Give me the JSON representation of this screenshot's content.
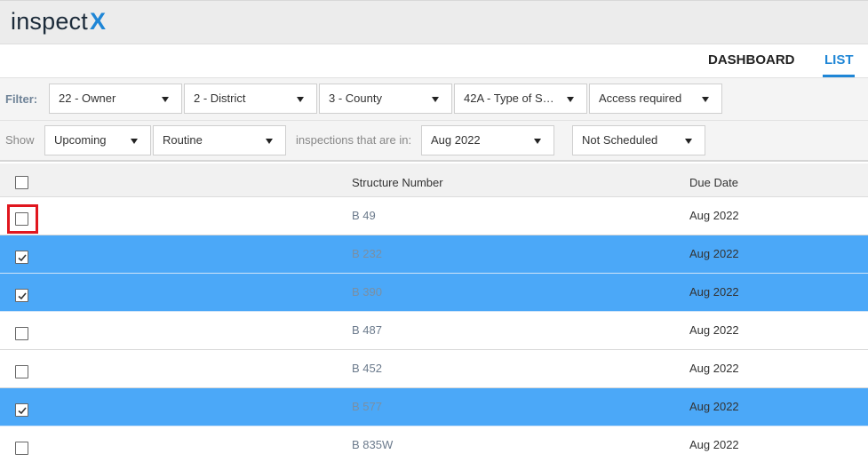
{
  "app": {
    "logo_text": "inspect",
    "logo_accent": "X"
  },
  "nav": {
    "dashboard": "DASHBOARD",
    "list": "LIST",
    "active": "LIST"
  },
  "filters": {
    "label": "Filter:",
    "owner": "22 - Owner",
    "district": "2 - District",
    "county": "3 - County",
    "type": "42A - Type of S…",
    "access": "Access required"
  },
  "show": {
    "label": "Show",
    "timing": "Upcoming",
    "kind": "Routine",
    "middle_text": "inspections that are in:",
    "month": "Aug 2022",
    "schedule": "Not Scheduled"
  },
  "table": {
    "headers": {
      "structure": "Structure Number",
      "due": "Due Date"
    },
    "rows": [
      {
        "structure": "B 49",
        "due": "Aug 2022",
        "checked": false
      },
      {
        "structure": "B 232",
        "due": "Aug 2022",
        "checked": true
      },
      {
        "structure": "B 390",
        "due": "Aug 2022",
        "checked": true
      },
      {
        "structure": "B 487",
        "due": "Aug 2022",
        "checked": false
      },
      {
        "structure": "B 452",
        "due": "Aug 2022",
        "checked": false
      },
      {
        "structure": "B 577",
        "due": "Aug 2022",
        "checked": true
      },
      {
        "structure": "B 835W",
        "due": "Aug 2022",
        "checked": false
      }
    ]
  },
  "colors": {
    "accent": "#1f86d6",
    "selected_row": "#4ba8f8",
    "highlight": "#e0161e"
  }
}
